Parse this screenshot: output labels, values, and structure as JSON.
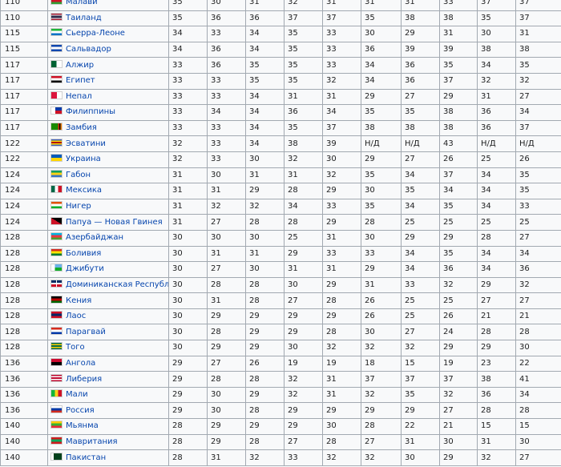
{
  "rows": [
    {
      "rank": "110",
      "country": "Малави",
      "flag": "malawi-flag-icon",
      "values": [
        "35",
        "30",
        "31",
        "32",
        "31",
        "31",
        "31",
        "33",
        "37",
        "37"
      ],
      "flag_colors": [
        "#000000",
        "#ce1126",
        "#339e35"
      ],
      "flag_dir": "h"
    },
    {
      "rank": "110",
      "country": "Таиланд",
      "flag": "thailand-flag-icon",
      "values": [
        "35",
        "36",
        "36",
        "37",
        "37",
        "35",
        "38",
        "38",
        "35",
        "37"
      ],
      "flag_colors": [
        "#a51931",
        "#f4f5f8",
        "#2d2a4a",
        "#2d2a4a",
        "#f4f5f8",
        "#a51931"
      ],
      "flag_dir": "h"
    },
    {
      "rank": "115",
      "country": "Сьерра-Леоне",
      "flag": "sierra-leone-flag-icon",
      "values": [
        "34",
        "33",
        "34",
        "35",
        "33",
        "30",
        "29",
        "31",
        "30",
        "31"
      ],
      "flag_colors": [
        "#1eb53a",
        "#ffffff",
        "#0072c6"
      ],
      "flag_dir": "h"
    },
    {
      "rank": "115",
      "country": "Сальвадор",
      "flag": "el-salvador-flag-icon",
      "values": [
        "34",
        "36",
        "34",
        "35",
        "33",
        "36",
        "39",
        "39",
        "38",
        "38"
      ],
      "flag_colors": [
        "#0f47af",
        "#ffffff",
        "#0f47af"
      ],
      "flag_dir": "h"
    },
    {
      "rank": "117",
      "country": "Алжир",
      "flag": "algeria-flag-icon",
      "values": [
        "33",
        "36",
        "35",
        "35",
        "33",
        "34",
        "36",
        "35",
        "34",
        "35"
      ],
      "flag_colors": [
        "#006233",
        "#ffffff"
      ],
      "flag_dir": "v"
    },
    {
      "rank": "117",
      "country": "Египет",
      "flag": "egypt-flag-icon",
      "values": [
        "33",
        "33",
        "35",
        "35",
        "32",
        "34",
        "36",
        "37",
        "32",
        "32"
      ],
      "flag_colors": [
        "#ce1126",
        "#ffffff",
        "#000000"
      ],
      "flag_dir": "h"
    },
    {
      "rank": "117",
      "country": "Непал",
      "flag": "nepal-flag-icon",
      "values": [
        "33",
        "33",
        "34",
        "31",
        "31",
        "29",
        "27",
        "29",
        "31",
        "27"
      ],
      "flag_colors": [
        "#dc143c",
        "#ffffff"
      ],
      "flag_dir": "nepal"
    },
    {
      "rank": "117",
      "country": "Филиппины",
      "flag": "philippines-flag-icon",
      "values": [
        "33",
        "34",
        "34",
        "36",
        "34",
        "35",
        "35",
        "38",
        "36",
        "34"
      ],
      "flag_colors": [
        "#0038a8",
        "#ce1126",
        "#ffffff"
      ],
      "flag_dir": "ph"
    },
    {
      "rank": "117",
      "country": "Замбия",
      "flag": "zambia-flag-icon",
      "values": [
        "33",
        "33",
        "34",
        "35",
        "37",
        "38",
        "38",
        "38",
        "36",
        "37"
      ],
      "flag_colors": [
        "#198a00",
        "#de2010",
        "#000000",
        "#ef7d00"
      ],
      "flag_dir": "zm"
    },
    {
      "rank": "122",
      "country": "Эсватини",
      "flag": "eswatini-flag-icon",
      "values": [
        "32",
        "33",
        "34",
        "38",
        "39",
        "Н/Д",
        "Н/Д",
        "43",
        "Н/Д",
        "Н/Д"
      ],
      "flag_colors": [
        "#3e5eb9",
        "#ffd900",
        "#b10c0c",
        "#ffd900",
        "#3e5eb9"
      ],
      "flag_dir": "h"
    },
    {
      "rank": "122",
      "country": "Украина",
      "flag": "ukraine-flag-icon",
      "values": [
        "32",
        "33",
        "30",
        "32",
        "30",
        "29",
        "27",
        "26",
        "25",
        "26"
      ],
      "flag_colors": [
        "#005bbb",
        "#ffd500"
      ],
      "flag_dir": "h"
    },
    {
      "rank": "124",
      "country": "Габон",
      "flag": "gabon-flag-icon",
      "values": [
        "31",
        "30",
        "31",
        "31",
        "32",
        "35",
        "34",
        "37",
        "34",
        "35"
      ],
      "flag_colors": [
        "#009e60",
        "#fcd116",
        "#3a75c4"
      ],
      "flag_dir": "h"
    },
    {
      "rank": "124",
      "country": "Мексика",
      "flag": "mexico-flag-icon",
      "values": [
        "31",
        "31",
        "29",
        "28",
        "29",
        "30",
        "35",
        "34",
        "34",
        "35"
      ],
      "flag_colors": [
        "#006847",
        "#ffffff",
        "#ce1126"
      ],
      "flag_dir": "v"
    },
    {
      "rank": "124",
      "country": "Нигер",
      "flag": "niger-flag-icon",
      "values": [
        "31",
        "32",
        "32",
        "34",
        "33",
        "35",
        "34",
        "35",
        "34",
        "33"
      ],
      "flag_colors": [
        "#e05206",
        "#ffffff",
        "#0db02b"
      ],
      "flag_dir": "h"
    },
    {
      "rank": "124",
      "country": "Папуа — Новая Гвинея",
      "flag": "papua-new-guinea-flag-icon",
      "values": [
        "31",
        "27",
        "28",
        "28",
        "29",
        "28",
        "25",
        "25",
        "25",
        "25"
      ],
      "flag_colors": [
        "#000000",
        "#ce1126"
      ],
      "flag_dir": "diag"
    },
    {
      "rank": "128",
      "country": "Азербайджан",
      "flag": "azerbaijan-flag-icon",
      "values": [
        "30",
        "30",
        "30",
        "25",
        "31",
        "30",
        "29",
        "29",
        "28",
        "27"
      ],
      "flag_colors": [
        "#00b5e2",
        "#ef3340",
        "#509e2f"
      ],
      "flag_dir": "h"
    },
    {
      "rank": "128",
      "country": "Боливия",
      "flag": "bolivia-flag-icon",
      "values": [
        "30",
        "31",
        "31",
        "29",
        "33",
        "33",
        "34",
        "35",
        "34",
        "34"
      ],
      "flag_colors": [
        "#d52b1e",
        "#f9e300",
        "#007934"
      ],
      "flag_dir": "h"
    },
    {
      "rank": "128",
      "country": "Джибути",
      "flag": "djibouti-flag-icon",
      "values": [
        "30",
        "27",
        "30",
        "31",
        "31",
        "29",
        "34",
        "36",
        "34",
        "36"
      ],
      "flag_colors": [
        "#6ab2e7",
        "#12ad2b",
        "#ffffff"
      ],
      "flag_dir": "dj"
    },
    {
      "rank": "128",
      "country": "Доминиканская Республика",
      "flag": "dominican-republic-flag-icon",
      "values": [
        "30",
        "28",
        "28",
        "30",
        "29",
        "31",
        "33",
        "32",
        "29",
        "32"
      ],
      "flag_colors": [
        "#002d62",
        "#ce1126",
        "#ffffff"
      ],
      "flag_dir": "quad"
    },
    {
      "rank": "128",
      "country": "Кения",
      "flag": "kenya-flag-icon",
      "values": [
        "30",
        "31",
        "28",
        "27",
        "28",
        "26",
        "25",
        "25",
        "27",
        "27"
      ],
      "flag_colors": [
        "#000000",
        "#bb0000",
        "#006600"
      ],
      "flag_dir": "h"
    },
    {
      "rank": "128",
      "country": "Лаос",
      "flag": "laos-flag-icon",
      "values": [
        "30",
        "29",
        "29",
        "29",
        "29",
        "26",
        "25",
        "26",
        "21",
        "21"
      ],
      "flag_colors": [
        "#ce1126",
        "#002868",
        "#ce1126"
      ],
      "flag_dir": "h"
    },
    {
      "rank": "128",
      "country": "Парагвай",
      "flag": "paraguay-flag-icon",
      "values": [
        "30",
        "28",
        "29",
        "29",
        "28",
        "30",
        "27",
        "24",
        "28",
        "28"
      ],
      "flag_colors": [
        "#d52b1e",
        "#ffffff",
        "#0038a8"
      ],
      "flag_dir": "h"
    },
    {
      "rank": "128",
      "country": "Того",
      "flag": "togo-flag-icon",
      "values": [
        "30",
        "29",
        "29",
        "30",
        "32",
        "32",
        "32",
        "29",
        "29",
        "30"
      ],
      "flag_colors": [
        "#006a4e",
        "#ffce00",
        "#006a4e",
        "#ffce00",
        "#006a4e"
      ],
      "flag_dir": "h"
    },
    {
      "rank": "136",
      "country": "Ангола",
      "flag": "angola-flag-icon",
      "values": [
        "29",
        "27",
        "26",
        "19",
        "19",
        "18",
        "15",
        "19",
        "23",
        "22"
      ],
      "flag_colors": [
        "#cc092f",
        "#000000"
      ],
      "flag_dir": "h"
    },
    {
      "rank": "136",
      "country": "Либерия",
      "flag": "liberia-flag-icon",
      "values": [
        "29",
        "28",
        "28",
        "32",
        "31",
        "37",
        "37",
        "37",
        "38",
        "41"
      ],
      "flag_colors": [
        "#bf0a30",
        "#ffffff",
        "#bf0a30",
        "#ffffff",
        "#bf0a30"
      ],
      "flag_dir": "h"
    },
    {
      "rank": "136",
      "country": "Мали",
      "flag": "mali-flag-icon",
      "values": [
        "29",
        "30",
        "29",
        "32",
        "31",
        "32",
        "35",
        "32",
        "36",
        "34"
      ],
      "flag_colors": [
        "#14b53a",
        "#fcd116",
        "#ce1126"
      ],
      "flag_dir": "v"
    },
    {
      "rank": "136",
      "country": "Россия",
      "flag": "russia-flag-icon",
      "values": [
        "29",
        "30",
        "28",
        "29",
        "29",
        "29",
        "29",
        "27",
        "28",
        "28"
      ],
      "flag_colors": [
        "#ffffff",
        "#0039a6",
        "#d52b1e"
      ],
      "flag_dir": "h"
    },
    {
      "rank": "140",
      "country": "Мьянма",
      "flag": "myanmar-flag-icon",
      "values": [
        "28",
        "29",
        "29",
        "29",
        "30",
        "28",
        "22",
        "21",
        "15",
        "15"
      ],
      "flag_colors": [
        "#fecb00",
        "#34b233",
        "#ea2839"
      ],
      "flag_dir": "h"
    },
    {
      "rank": "140",
      "country": "Мавритания",
      "flag": "mauritania-flag-icon",
      "values": [
        "28",
        "29",
        "28",
        "27",
        "28",
        "27",
        "31",
        "30",
        "31",
        "30"
      ],
      "flag_colors": [
        "#d01c1f",
        "#00a95c",
        "#d01c1f"
      ],
      "flag_dir": "h"
    },
    {
      "rank": "140",
      "country": "Пакистан",
      "flag": "pakistan-flag-icon",
      "values": [
        "28",
        "31",
        "32",
        "33",
        "32",
        "32",
        "30",
        "29",
        "32",
        "27"
      ],
      "flag_colors": [
        "#ffffff",
        "#01411c",
        "#01411c",
        "#01411c"
      ],
      "flag_dir": "v"
    }
  ]
}
